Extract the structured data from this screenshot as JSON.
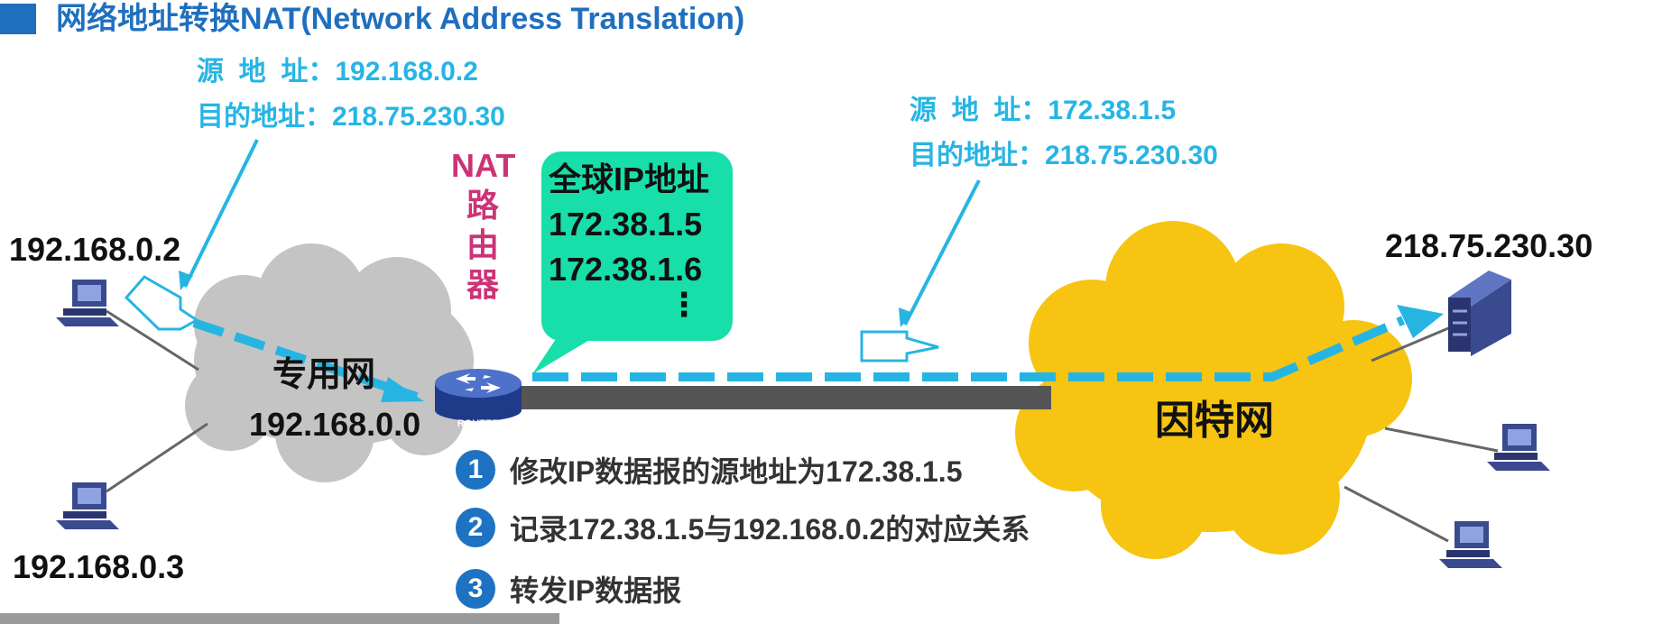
{
  "title": "网络地址转换NAT(Network Address Translation)",
  "packet_left": {
    "src_label": "源  地  址",
    "src_value": "192.168.0.2",
    "dst_label": "目的地址",
    "dst_value": "218.75.230.30"
  },
  "packet_right": {
    "src_label": "源  地  址",
    "src_value": "172.38.1.5",
    "dst_label": "目的地址",
    "dst_value": "218.75.230.30"
  },
  "nat_router_label": [
    "NAT",
    "路",
    "由",
    "器"
  ],
  "router_icon_label": "ROUTER",
  "global_pool": {
    "title": "全球IP地址",
    "addresses": [
      "172.38.1.5",
      "172.38.1.6"
    ],
    "more": "⋮"
  },
  "private_net": {
    "name": "专用网",
    "address": "192.168.0.0"
  },
  "internet": {
    "name": "因特网"
  },
  "hosts": {
    "host_a": "192.168.0.2",
    "host_b": "192.168.0.3",
    "server": "218.75.230.30"
  },
  "steps": [
    {
      "num": "1",
      "text": "修改IP数据报的源地址为172.38.1.5"
    },
    {
      "num": "2",
      "text": "记录172.38.1.5与192.168.0.2的对应关系"
    },
    {
      "num": "3",
      "text": "转发IP数据报"
    }
  ],
  "colors": {
    "accent": "#1f6fbf",
    "packet_text": "#26b5e3",
    "dashed_flow": "#26b5e3",
    "nat_label": "#cc3377",
    "pool_bg": "#18dfaa",
    "private_cloud": "#c4c4c4",
    "internet_cloud": "#f6c411",
    "link": "#555555",
    "host_icon": "#3a4a8f"
  }
}
